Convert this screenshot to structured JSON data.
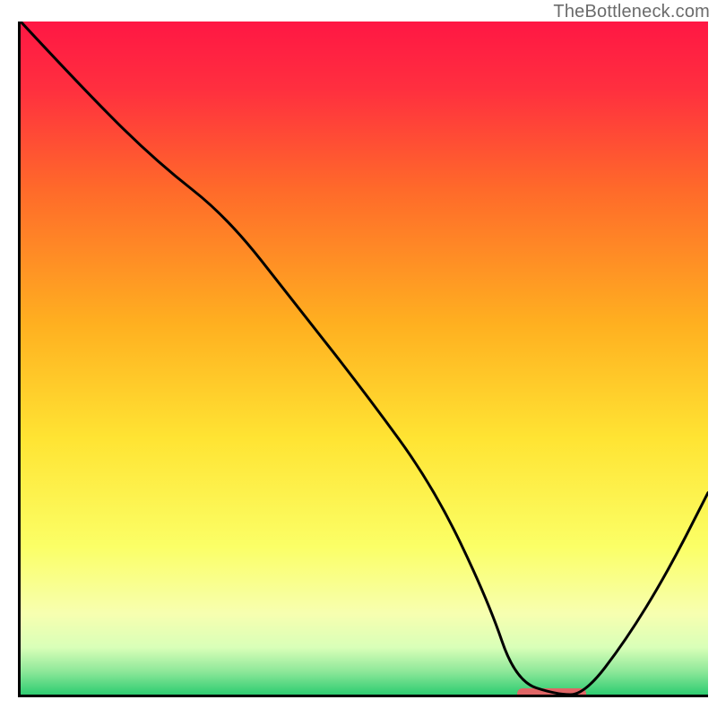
{
  "watermark": "TheBottleneck.com",
  "chart_data": {
    "type": "line",
    "title": "",
    "xlabel": "",
    "ylabel": "",
    "xlim": [
      0,
      100
    ],
    "ylim": [
      0,
      100
    ],
    "x": [
      0,
      10,
      20,
      30,
      40,
      50,
      60,
      68,
      72,
      78,
      82,
      88,
      94,
      100
    ],
    "values": [
      100,
      89,
      79,
      71,
      58,
      45,
      31,
      14,
      2,
      0,
      0,
      8,
      18,
      30
    ],
    "grid": false,
    "legend": null,
    "marker": {
      "x_start": 72,
      "x_end": 82,
      "y": 0
    },
    "gradient_stops": [
      {
        "pos": 0.0,
        "color": "#ff1744"
      },
      {
        "pos": 0.1,
        "color": "#ff2f3f"
      },
      {
        "pos": 0.25,
        "color": "#ff6a2a"
      },
      {
        "pos": 0.45,
        "color": "#ffb020"
      },
      {
        "pos": 0.62,
        "color": "#ffe433"
      },
      {
        "pos": 0.78,
        "color": "#fbff66"
      },
      {
        "pos": 0.88,
        "color": "#f7ffb0"
      },
      {
        "pos": 0.93,
        "color": "#d9ffb8"
      },
      {
        "pos": 0.965,
        "color": "#8fe89a"
      },
      {
        "pos": 1.0,
        "color": "#2ecc71"
      }
    ]
  }
}
